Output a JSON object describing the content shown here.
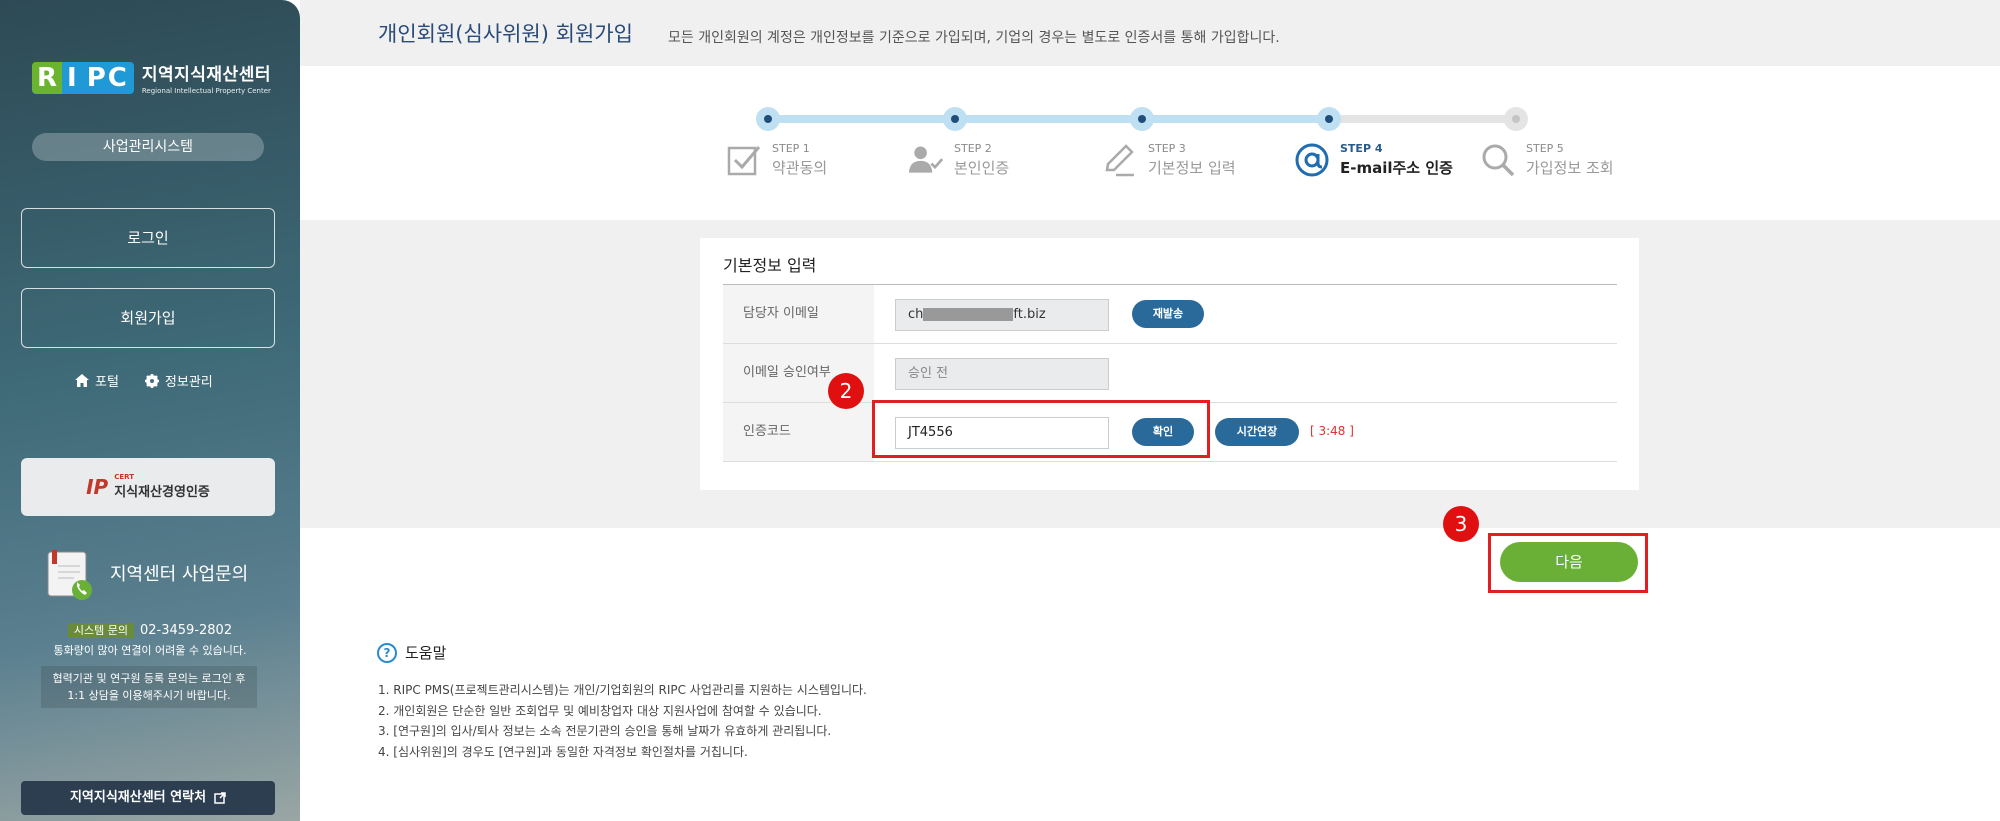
{
  "sidebar": {
    "logo_mark": "RIPC",
    "logo_ko": "지역지식재산센터",
    "logo_en": "Regional Intellectual Property Center",
    "system_label": "사업관리시스템",
    "login_label": "로그인",
    "signup_label": "회원가입",
    "portal_label": "포털",
    "info_label": "정보관리",
    "cert_badge": "IP",
    "cert_small": "CERT",
    "cert_label": "지식재산경영인증",
    "inquiry_title": "지역센터 사업문의",
    "phone_tag": "시스템 문의",
    "phone": "02-3459-2802",
    "phone_note": "통화량이 많아 연결이 어려울 수 있습니다.",
    "note_line1": "협력기관 및 연구원 등록 문의는 로그인 후",
    "note_line2": "1:1 상담을 이용해주시기 바랍니다.",
    "contact_label": "지역지식재산센터 연락처"
  },
  "header": {
    "title": "개인회원(심사위원) 회원가입",
    "description": "모든 개인회원의 계정은 개인정보를 기준으로 가입되며, 기업의 경우는 별도로 인증서를 통해 가입합니다."
  },
  "steps": [
    {
      "num": "STEP 1",
      "label": "약관동의",
      "icon": "checkbox-icon"
    },
    {
      "num": "STEP 2",
      "label": "본인인증",
      "icon": "user-check-icon"
    },
    {
      "num": "STEP 3",
      "label": "기본정보 입력",
      "icon": "pencil-icon"
    },
    {
      "num": "STEP 4",
      "label": "E-mail주소 인증",
      "icon": "at-sign-icon"
    },
    {
      "num": "STEP 5",
      "label": "가입정보 조회",
      "icon": "search-icon"
    }
  ],
  "current_step": 4,
  "form": {
    "title": "기본정보 입력",
    "email_label": "담당자 이메일",
    "email_prefix": "ch",
    "email_suffix": "ft.biz",
    "resend_label": "재발송",
    "approval_label": "이메일 승인여부",
    "approval_value": "승인 전",
    "code_label": "인증코드",
    "code_value": "JT4556",
    "confirm_label": "확인",
    "extend_label": "시간연장",
    "timer": "[ 3:48 ]"
  },
  "annotations": {
    "badge2": "2",
    "badge3": "3"
  },
  "next_label": "다음",
  "help": {
    "title": "도움말",
    "items": [
      "1. RIPC PMS(프로젝트관리시스템)는 개인/기업회원의 RIPC 사업관리를 지원하는 시스템입니다.",
      "2. 개인회원은 단순한 일반 조회업무 및 예비창업자 대상 지원사업에 참여할 수 있습니다.",
      "3. [연구원]의 입사/퇴사 정보는 소속 전문기관의 승인을 통해 날짜가 유효하게 관리됩니다.",
      "4. [심사위원]의 경우도 [연구원]과 동일한 자격정보 확인절차를 거칩니다."
    ]
  }
}
